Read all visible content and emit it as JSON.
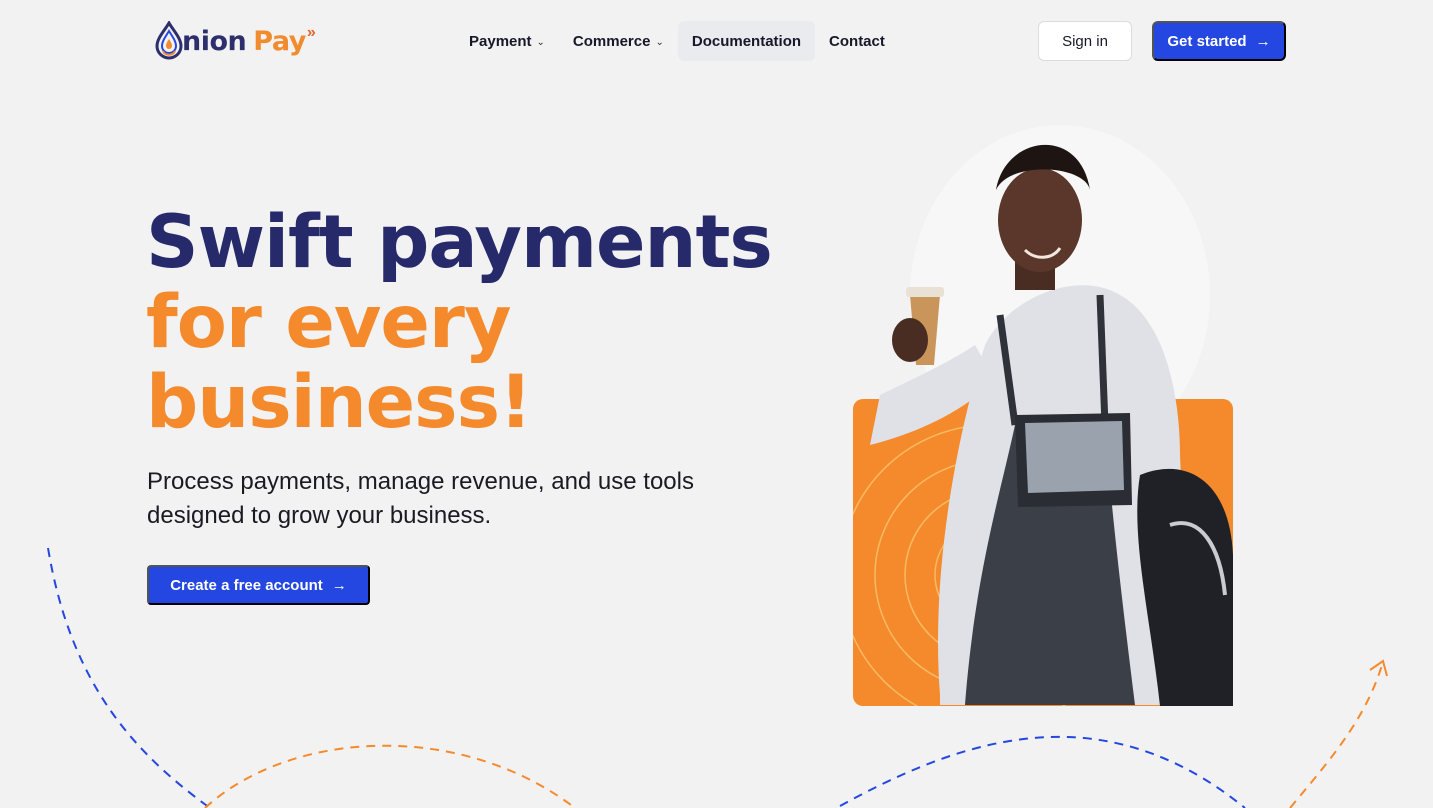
{
  "brand": {
    "name_part1": "nion",
    "name_part2": "Pay",
    "logo_icon": "droplet-o-logo",
    "chevron": "»",
    "colors": {
      "navy": "#2c2f6b",
      "orange": "#f28a2e"
    }
  },
  "nav": {
    "items": [
      {
        "label": "Payment",
        "has_dropdown": true
      },
      {
        "label": "Commerce",
        "has_dropdown": true
      },
      {
        "label": "Documentation",
        "has_dropdown": false,
        "active": true
      },
      {
        "label": "Contact",
        "has_dropdown": false
      }
    ],
    "dropdown_icon": "chevron-down-icon"
  },
  "header_actions": {
    "sign_in_label": "Sign in",
    "get_started_label": "Get started",
    "arrow_icon": "arrow-right-icon"
  },
  "hero": {
    "headline_line1": "Swift payments",
    "headline_line2": "for every",
    "headline_line3": "business!",
    "subtitle": "Process payments, manage revenue, and use tools designed to grow your business.",
    "cta_label": "Create a free account"
  },
  "colors": {
    "background": "#f2f2f2",
    "primary_blue": "#2347e0",
    "headline_navy": "#262a6b",
    "headline_orange": "#f58a2c",
    "card_orange": "#f58a2c"
  }
}
